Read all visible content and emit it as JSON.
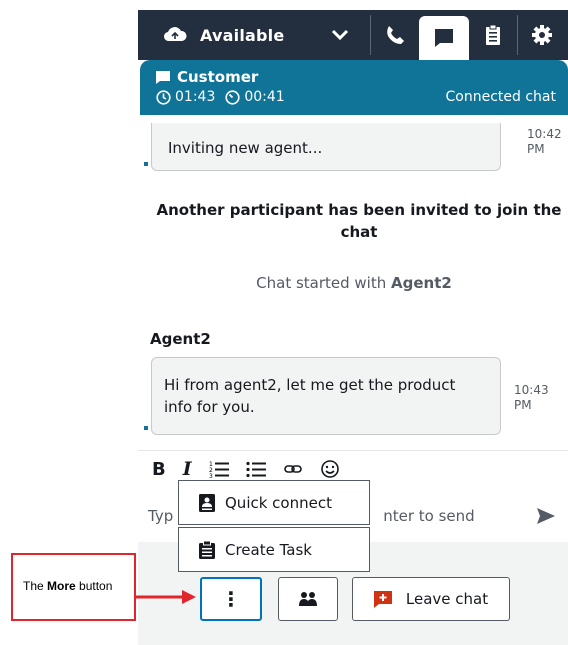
{
  "topbar": {
    "status_label": "Available",
    "buttons": [
      "phone-icon",
      "chat-icon",
      "clipboard-icon",
      "gear-icon"
    ],
    "active_button": "chat-icon",
    "background": "#232f3e"
  },
  "contact": {
    "name": "Customer",
    "contact_duration": "01:43",
    "hold_duration": "00:41",
    "state": "Connected chat",
    "color": "#0f7497"
  },
  "transcript": {
    "messages": [
      {
        "type": "agent",
        "text": "Inviting new agent...",
        "time": "10:42 PM"
      },
      {
        "type": "system",
        "text": "Another participant has been invited to join the chat"
      },
      {
        "type": "event",
        "prefix": "Chat started with",
        "name": "Agent2"
      },
      {
        "type": "participant",
        "sender": "Agent2",
        "text": "Hi from agent2, let me get the product info for you.",
        "time": "10:43 PM"
      }
    ]
  },
  "composer": {
    "toolbar": [
      "B",
      "I",
      "numbered-list-icon",
      "bulleted-list-icon",
      "link-icon",
      "emoji-icon"
    ],
    "placeholder_left": "Typ",
    "placeholder_right": "nter to send"
  },
  "more_menu": {
    "items": [
      {
        "label": "Quick connect",
        "icon": "contact-card-icon"
      },
      {
        "label": "Create Task",
        "icon": "clipboard-icon"
      }
    ]
  },
  "bottombar": {
    "more_label": "⋮",
    "leave_label": "Leave chat"
  },
  "callout": {
    "prefix": "The ",
    "bold": "More",
    "suffix": " button",
    "color": "#e0252d"
  }
}
